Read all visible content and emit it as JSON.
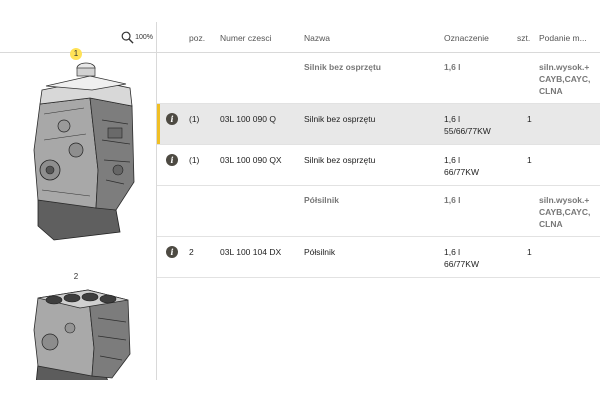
{
  "zoom": {
    "label": "100%"
  },
  "diagram": {
    "callouts": [
      "1",
      "2"
    ]
  },
  "table": {
    "columns": {
      "poz": "poz.",
      "numer": "Numer czesci",
      "nazwa": "Nazwa",
      "oznaczenie": "Oznaczenie",
      "szt": "szt.",
      "podanie": "Podanie m..."
    },
    "rows": [
      {
        "type": "group",
        "nazwa": "Silnik bez osprzętu",
        "oznaczenie": "1,6 l",
        "oznaczenie2": "",
        "podanie": [
          "siln.wysok.+",
          "CAYB,CAYC,",
          "CLNA"
        ]
      },
      {
        "type": "item",
        "selected": true,
        "poz": "(1)",
        "numer": "03L 100 090 Q",
        "nazwa": "Silnik bez osprzętu",
        "oznaczenie": "1,6 l",
        "oznaczenie2": "55/66/77KW",
        "szt": "1"
      },
      {
        "type": "item",
        "selected": false,
        "poz": "(1)",
        "numer": "03L 100 090 QX",
        "nazwa": "Silnik bez osprzętu",
        "oznaczenie": "1,6 l",
        "oznaczenie2": "66/77KW",
        "szt": "1"
      },
      {
        "type": "group",
        "nazwa": "Półsilnik",
        "oznaczenie": "1,6 l",
        "oznaczenie2": "",
        "podanie": [
          "siln.wysok.+",
          "CAYB,CAYC,",
          "CLNA"
        ]
      },
      {
        "type": "item",
        "selected": false,
        "poz": "2",
        "numer": "03L 100 104 DX",
        "nazwa": "Półsilnik",
        "oznaczenie": "1,6 l",
        "oznaczenie2": "66/77KW",
        "szt": "1"
      }
    ]
  },
  "colors": {
    "accent": "#f0bf25",
    "selected_row": "#e8e8e8",
    "info_icon": "#4d4a42"
  }
}
